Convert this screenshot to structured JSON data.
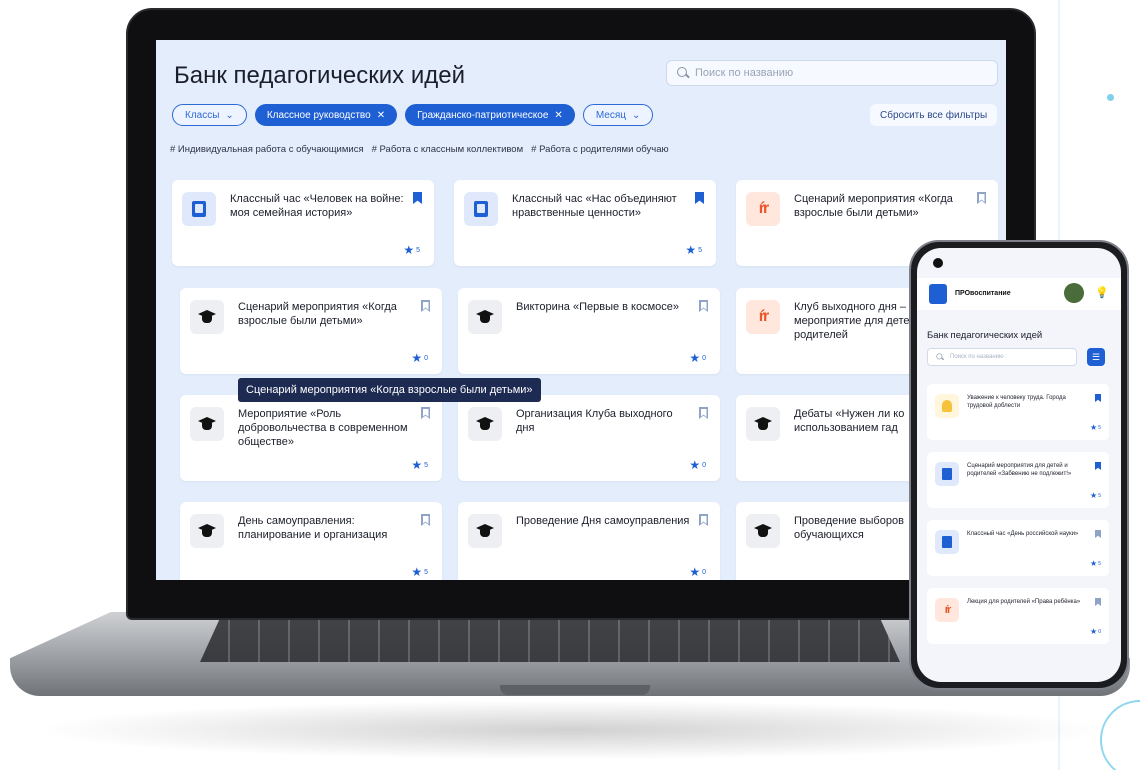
{
  "app": {
    "title": "Банк педагогических идей",
    "search_placeholder": "Поиск по названию"
  },
  "filters": {
    "chips": [
      {
        "label": "Классы",
        "style": "outline",
        "icon": "chevron-down-icon"
      },
      {
        "label": "Классное руководство",
        "style": "filled",
        "icon": "close-icon"
      },
      {
        "label": "Гражданско-патриотическое",
        "style": "filled",
        "icon": "close-icon"
      },
      {
        "label": "Месяц",
        "style": "outline",
        "icon": "chevron-down-icon"
      }
    ],
    "reset_label": "Сбросить все фильтры"
  },
  "tags": [
    "# Индивидуальная работа с обучающимися",
    "# Работа с классным коллективом",
    "# Работа с родителями обучаю"
  ],
  "cards": [
    {
      "title": "Классный час «Человек на войне: моя семейная история»",
      "icon": "book-icon",
      "bookmarked": true,
      "rating": "5"
    },
    {
      "title": "Классный час «Нас объединяют нравственные ценности»",
      "icon": "book-icon",
      "bookmarked": true,
      "rating": "5"
    },
    {
      "title": "Сценарий мероприятия «Когда взрослые были детьми»",
      "icon": "family-icon",
      "bookmarked": false,
      "rating": "5"
    },
    {
      "title": "Сценарий мероприятия «Когда взрослые были детьми»",
      "icon": "graduation-cap-icon",
      "bookmarked": false,
      "rating": "0"
    },
    {
      "title": "Викторина «Первые в космосе»",
      "icon": "graduation-cap-icon",
      "bookmarked": false,
      "rating": "0"
    },
    {
      "title": "Клуб выходного дня – мероприятие для детей и родителей",
      "icon": "family-icon",
      "bookmarked": false,
      "rating": "0"
    },
    {
      "title": "Мероприятие «Роль добровольчества в современном обществе»",
      "icon": "graduation-cap-icon",
      "bookmarked": false,
      "rating": "5"
    },
    {
      "title": "Организация Клуба выходного дня",
      "icon": "graduation-cap-icon",
      "bookmarked": false,
      "rating": "0"
    },
    {
      "title": "Дебаты «Нужен ли ко использованием гад",
      "icon": "graduation-cap-icon",
      "bookmarked": false,
      "rating": "0"
    },
    {
      "title": "День самоуправления: планирование и организация",
      "icon": "graduation-cap-icon",
      "bookmarked": false,
      "rating": "5"
    },
    {
      "title": "Проведение Дня самоуправления",
      "icon": "graduation-cap-icon",
      "bookmarked": false,
      "rating": "0"
    },
    {
      "title": "Проведение выборов обучающихся",
      "icon": "graduation-cap-icon",
      "bookmarked": false,
      "rating": "0"
    }
  ],
  "tooltip": "Сценарий мероприятия «Когда взрослые были детьми»",
  "phone": {
    "brand": "ПРОвоспитание",
    "title": "Банк педагогических идей",
    "search_placeholder": "Поиск по названию",
    "cards": [
      {
        "title": "Уважение к человеку труда. Города трудовой доблести",
        "icon": "bell-icon",
        "bookmarked": true,
        "rating": "5"
      },
      {
        "title": "Сценарий мероприятия для детей и родителей «Забвению не подлежит!»",
        "icon": "book-icon",
        "bookmarked": true,
        "rating": "5"
      },
      {
        "title": "Классный час «День российской науки»",
        "icon": "book-icon",
        "bookmarked": false,
        "rating": "5"
      },
      {
        "title": "Лекция для родителей «Права ребёнка»",
        "icon": "family-icon",
        "bookmarked": false,
        "rating": "0"
      }
    ]
  },
  "colors": {
    "accent": "#1f5fd4",
    "screen_bg": "#e3edfb",
    "tooltip_bg": "#1d2a52"
  }
}
